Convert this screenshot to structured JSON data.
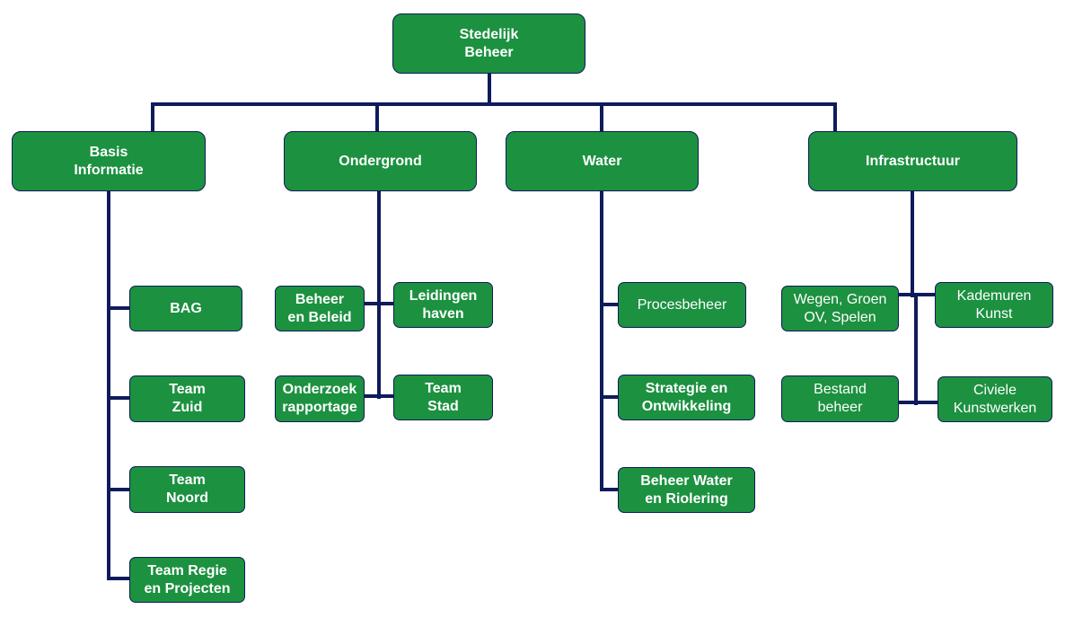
{
  "diagram": {
    "type": "org-chart",
    "colors": {
      "box_fill": "#1c9140",
      "box_border": "#0f1b5a",
      "line": "#0f1b5a",
      "text": "#ffffff"
    },
    "root": {
      "label": "Stedelijk\nBeheer"
    },
    "departments": [
      {
        "label": "Basis\nInformatie",
        "children": [
          "BAG",
          "Team\nZuid",
          "Team\nNoord",
          "Team Regie\nen Projecten"
        ]
      },
      {
        "label": "Ondergrond",
        "children": [
          "Beheer\nen Beleid",
          "Leidingen\nhaven",
          "Onderzoek\nrapportage",
          "Team\nStad"
        ]
      },
      {
        "label": "Water",
        "children": [
          "Procesbeheer",
          "Strategie en\nOntwikkeling",
          "Beheer Water\nen Riolering"
        ]
      },
      {
        "label": "Infrastructuur",
        "children": [
          "Wegen, Groen\nOV, Spelen",
          "Kademuren\nKunst",
          "Bestand\nbeheer",
          "Civiele\nKunstwerken"
        ]
      }
    ]
  }
}
